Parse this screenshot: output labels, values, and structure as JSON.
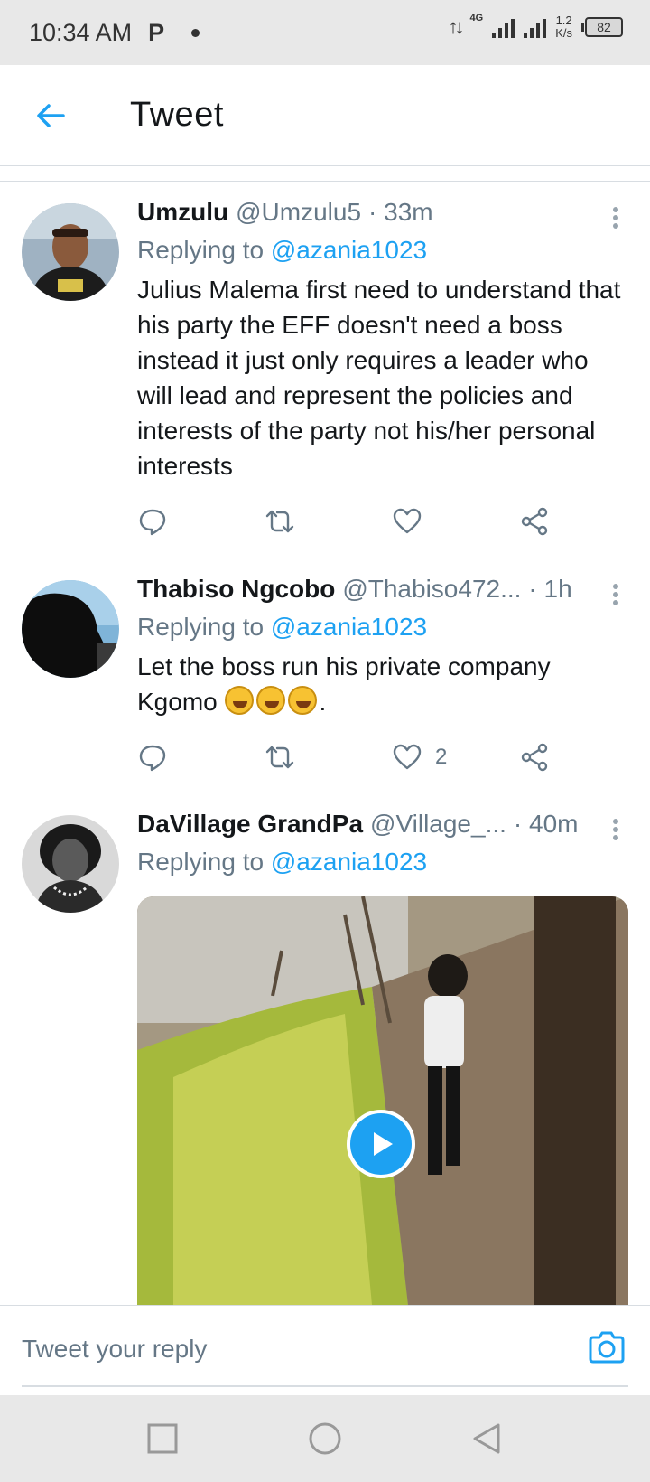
{
  "status_bar": {
    "time": "10:34 AM",
    "app_indicator": "P",
    "network_type": "4G",
    "speed_value": "1.2",
    "speed_unit": "K/s",
    "battery": "82"
  },
  "header": {
    "title": "Tweet",
    "back_icon": "arrow-left-icon"
  },
  "colors": {
    "accent": "#1da1f2",
    "text_primary": "#14171a",
    "text_secondary": "#657786",
    "divider": "#d8dde2"
  },
  "tweets": [
    {
      "name": "Umzulu",
      "handle": "@Umzulu5",
      "time": "· 33m",
      "replying_prefix": "Replying to",
      "replying_to": "@azania1023",
      "text": "Julius  Malema first need to understand that his party the EFF doesn't need a boss instead it just only requires a leader who will lead and represent the policies and interests of the party not his/her personal interests",
      "likes": ""
    },
    {
      "name": "Thabiso Ngcobo",
      "handle": "@Thabiso472...",
      "time": "· 1h",
      "replying_prefix": "Replying to",
      "replying_to": "@azania1023",
      "text": "Let the boss run his private company Kgomo",
      "text_suffix": ".",
      "emoji": "rolling-on-floor-laughing",
      "emoji_count": 3,
      "likes": "2"
    },
    {
      "name": "DaVillage GrandPa",
      "handle": "@Village_...",
      "time": "· 40m",
      "replying_prefix": "Replying to",
      "replying_to": "@azania1023",
      "media": "video",
      "media_icon": "play-icon"
    }
  ],
  "reply_bar": {
    "placeholder": "Tweet your reply",
    "camera_icon": "camera-icon"
  },
  "nav_bar": {
    "recents_icon": "square-icon",
    "home_icon": "circle-icon",
    "back_icon": "triangle-back-icon"
  }
}
